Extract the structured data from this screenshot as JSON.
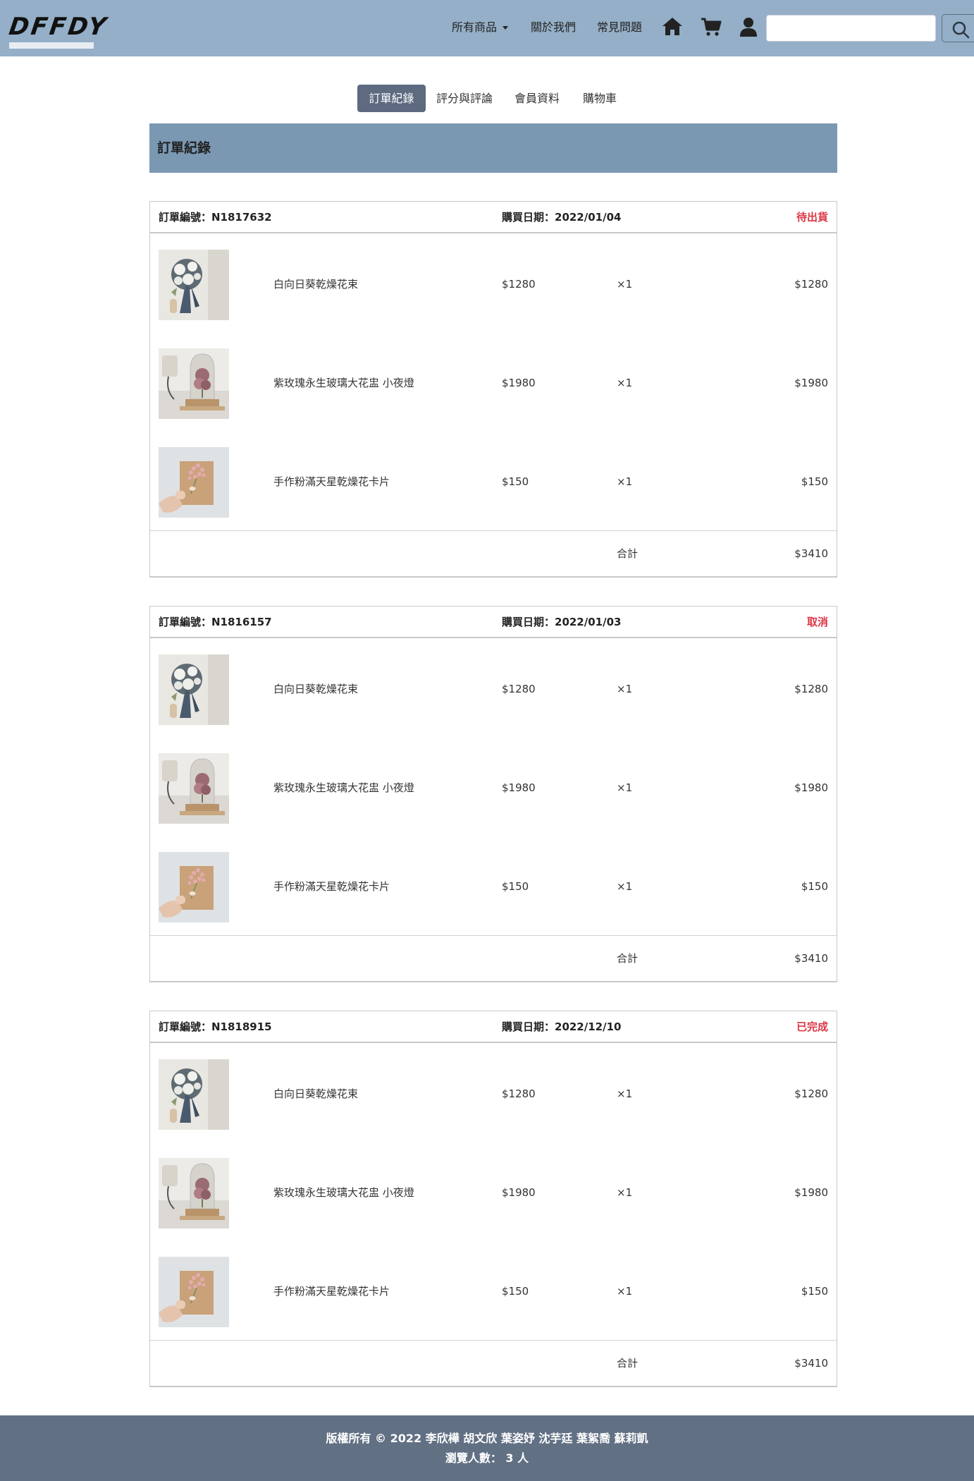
{
  "brand": {
    "logo": "DFFDY"
  },
  "nav": {
    "all_products": "所有商品",
    "about": "關於我們",
    "faq": "常見問題",
    "icons": [
      "home-icon",
      "cart-icon",
      "user-icon"
    ],
    "search_value": "",
    "search_icon": "search-icon"
  },
  "tabs": [
    {
      "label": "訂單紀錄",
      "active": true
    },
    {
      "label": "評分與評論",
      "active": false
    },
    {
      "label": "會員資料",
      "active": false
    },
    {
      "label": "購物車",
      "active": false
    }
  ],
  "section": {
    "title": "訂單紀錄"
  },
  "orders": [
    {
      "id": "訂單編號：N1817632",
      "date": "購買日期：2022/01/04",
      "status": "待出貨",
      "items": [
        {
          "name": "白向日葵乾燥花束",
          "price": "$1280",
          "qty": "×1",
          "subtotal": "$1280"
        },
        {
          "name": "紫玫瑰永生玻璃大花盅 小夜燈",
          "price": "$1980",
          "qty": "×1",
          "subtotal": "$1980"
        },
        {
          "name": "手作粉滿天星乾燥花卡片",
          "price": "$150",
          "qty": "×1",
          "subtotal": "$150"
        }
      ],
      "total_label": "合計",
      "total": "$3410"
    },
    {
      "id": "訂單編號：N1816157",
      "date": "購買日期：2022/01/03",
      "status": "取消",
      "items": [
        {
          "name": "白向日葵乾燥花束",
          "price": "$1280",
          "qty": "×1",
          "subtotal": "$1280"
        },
        {
          "name": "紫玫瑰永生玻璃大花盅 小夜燈",
          "price": "$1980",
          "qty": "×1",
          "subtotal": "$1980"
        },
        {
          "name": "手作粉滿天星乾燥花卡片",
          "price": "$150",
          "qty": "×1",
          "subtotal": "$150"
        }
      ],
      "total_label": "合計",
      "total": "$3410"
    },
    {
      "id": "訂單編號：N1818915",
      "date": "購買日期：2022/12/10",
      "status": "已完成",
      "items": [
        {
          "name": "白向日葵乾燥花束",
          "price": "$1280",
          "qty": "×1",
          "subtotal": "$1280"
        },
        {
          "name": "紫玫瑰永生玻璃大花盅 小夜燈",
          "price": "$1980",
          "qty": "×1",
          "subtotal": "$1980"
        },
        {
          "name": "手作粉滿天星乾燥花卡片",
          "price": "$150",
          "qty": "×1",
          "subtotal": "$150"
        }
      ],
      "total_label": "合計",
      "total": "$3410"
    }
  ],
  "footer": {
    "copyright": "版權所有 © 2022 李欣樺 胡文欣 葉姿妤 沈芋廷 葉絮喬 蘇莉凱",
    "visitors": "瀏覽人數： 3 人"
  },
  "colors": {
    "navbar": "#94afc7",
    "section_header": "#7b98b3",
    "active_tab": "#5d6a80",
    "status": "#dc3545",
    "footer": "#627084"
  }
}
